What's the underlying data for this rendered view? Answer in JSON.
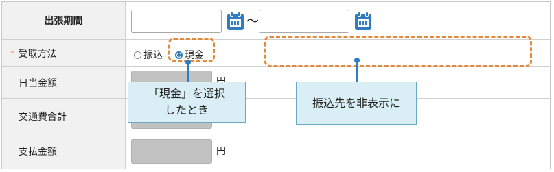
{
  "form": {
    "rows": [
      {
        "label": "出張期間"
      },
      {
        "label": "受取方法",
        "required_mark": "*"
      },
      {
        "label": "日当金額"
      },
      {
        "label": "交通費合計"
      },
      {
        "label": "支払金額"
      }
    ],
    "date_range_separator": "〜",
    "payment_options": [
      {
        "label": "振込",
        "selected": false
      },
      {
        "label": "現金",
        "selected": true
      }
    ],
    "currency_unit": "円"
  },
  "annotations": {
    "cash_callout": "「現金」を選択\nしたとき",
    "hidden_callout": "振込先を非表示に"
  },
  "colors": {
    "highlight_dash": "#e38a3a",
    "callout_bg": "#d9eef5",
    "accent_blue": "#2f7cc0",
    "label_bg": "#f1f1f1"
  }
}
